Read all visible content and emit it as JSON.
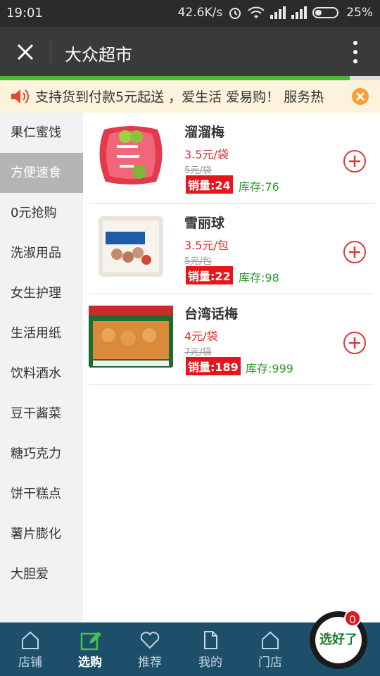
{
  "status_bar": {
    "time": "19:01",
    "net_speed": "42.6K/s",
    "battery": "25%"
  },
  "title_bar": {
    "title": "大众超市",
    "progress_fraction": 0.92
  },
  "notice": {
    "text": "支持货到付款5元起送 ，爱生活 爱易购！ 服务热"
  },
  "sidebar": {
    "categories": [
      {
        "label": "果仁蜜饯"
      },
      {
        "label": "方便速食",
        "active": true
      },
      {
        "label": "0元抢购"
      },
      {
        "label": "洗淑用品"
      },
      {
        "label": "女生护理"
      },
      {
        "label": "生活用纸"
      },
      {
        "label": "饮料酒水"
      },
      {
        "label": "豆干酱菜"
      },
      {
        "label": "糖巧克力"
      },
      {
        "label": "饼干糕点"
      },
      {
        "label": "薯片膨化"
      },
      {
        "label": "大胆爱"
      }
    ]
  },
  "products": [
    {
      "name": "溜溜梅",
      "price": "3.5元/袋",
      "old_price": "5元/袋",
      "sales": "销量:24",
      "stock": "库存:76"
    },
    {
      "name": "雪丽球",
      "price": "3.5元/包",
      "old_price": "5元/包",
      "sales": "销量:22",
      "stock": "库存:98"
    },
    {
      "name": "台湾话梅",
      "price": "4元/袋",
      "old_price": "7元/袋",
      "sales": "销量:189",
      "stock": "库存:999"
    }
  ],
  "tab_bar": {
    "tabs": [
      {
        "label": "店铺",
        "icon": "home-icon"
      },
      {
        "label": "选购",
        "icon": "edit-icon",
        "active": true
      },
      {
        "label": "推荐",
        "icon": "heart-icon"
      },
      {
        "label": "我的",
        "icon": "document-icon"
      },
      {
        "label": "门店",
        "icon": "home-icon"
      }
    ],
    "cart_label": "选好了",
    "cart_count": "0"
  },
  "colors": {
    "accent_green": "#4cb83a",
    "price_red": "#e02a2a",
    "tab_bar_bg": "#1e4f6a"
  }
}
